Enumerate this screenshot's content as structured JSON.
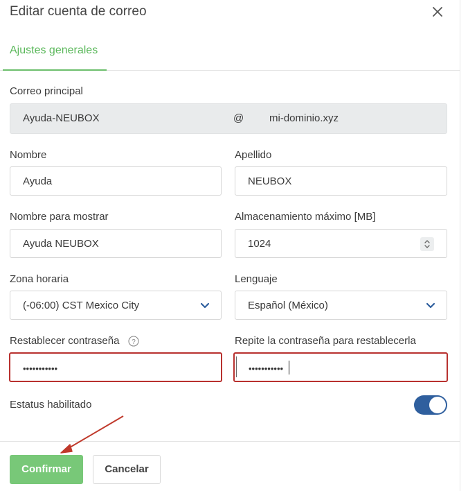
{
  "dialog": {
    "title": "Editar cuenta de correo",
    "close_icon": "close-icon"
  },
  "tabs": [
    {
      "label": "Ajustes generales",
      "active": true
    }
  ],
  "form": {
    "correo_principal": {
      "label": "Correo principal",
      "user": "Ayuda-NEUBOX",
      "at": "@",
      "domain": "mi-dominio.xyz"
    },
    "nombre": {
      "label": "Nombre",
      "value": "Ayuda"
    },
    "apellido": {
      "label": "Apellido",
      "value": "NEUBOX"
    },
    "nombre_mostrar": {
      "label": "Nombre para mostrar",
      "value": "Ayuda NEUBOX"
    },
    "almacenamiento": {
      "label": "Almacenamiento máximo [MB]",
      "value": "1024"
    },
    "zona_horaria": {
      "label": "Zona horaria",
      "value": "(-06:00) CST Mexico City"
    },
    "lenguaje": {
      "label": "Lenguaje",
      "value": "Español (México)"
    },
    "password": {
      "label": "Restablecer contraseña",
      "value": "•••••••••••",
      "help_icon": "question-circle-icon"
    },
    "password_repeat": {
      "label": "Repite la contraseña para restablecerla",
      "value": "•••••••••••"
    },
    "estatus": {
      "label": "Estatus habilitado",
      "enabled": true
    }
  },
  "buttons": {
    "confirm": "Confirmar",
    "cancel": "Cancelar"
  },
  "colors": {
    "accent_green": "#5bb85b",
    "confirm_button": "#78c878",
    "error_border": "#b8312f",
    "toggle_on": "#2f5f9e",
    "annotation_arrow": "#c0392b"
  }
}
